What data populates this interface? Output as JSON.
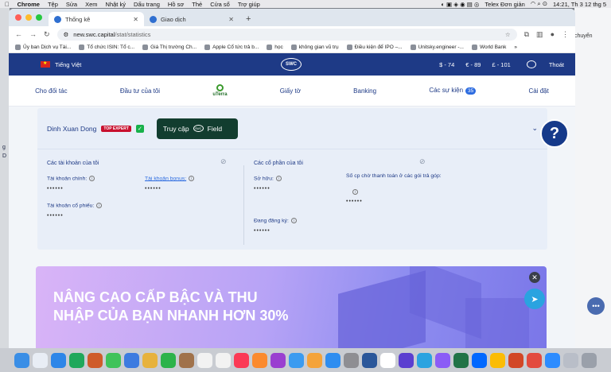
{
  "menubar": {
    "app": "Chrome",
    "items": [
      "Tệp",
      "Sửa",
      "Xem",
      "Nhật ký",
      "Dấu trang",
      "Hồ sơ",
      "Thẻ",
      "Cửa sổ",
      "Trợ giúp"
    ],
    "status_app": "Telex Đơn giản",
    "clock": "14:21, Th 3 12 thg 5"
  },
  "browser": {
    "tabs": [
      {
        "label": "Thống kê",
        "active": true
      },
      {
        "label": "Giao dịch",
        "active": false
      }
    ],
    "url_host": "new.swc.capital",
    "url_path": "/stat/statistics",
    "side_text": "chuyển"
  },
  "bookmarks": [
    "Ủy ban Dịch vụ Tài...",
    "Tổ chức ISIN: Tổ c...",
    "Giá Thị trường Ch...",
    "Apple Cổ tức trả b...",
    "học",
    "không gian vũ trụ",
    "Điều kiện để IPO –...",
    "Unitsky.engineer -...",
    "World Bank"
  ],
  "site": {
    "language": "Tiếng Việt",
    "logo": "SWC",
    "rates": [
      "$ - 74",
      "€ - 89",
      "£ - 101"
    ],
    "logout": "Thoát",
    "nav": {
      "partners": "Cho đối tác",
      "my_investment": "Đầu tư của tôi",
      "uterra": "uTerra",
      "documents": "Giấy tờ",
      "banking": "Banking",
      "events": "Các sự kiện",
      "events_count": "35",
      "settings": "Cài đặt"
    },
    "user": {
      "name": "Dinh Xuan Dong",
      "badge": "TOP EXPERT",
      "access_prefix": "Truy cập",
      "access_logo": "SWC",
      "access_suffix": "Field"
    },
    "accounts": {
      "title": "Các tài khoản của tôi",
      "main": "Tài khoản chính:",
      "main_value": "••••••",
      "bonus": "Tài khoản bonus:",
      "bonus_value": "••••••",
      "stock": "Tài khoản cổ phiếu:",
      "stock_value": "••••••"
    },
    "shares": {
      "title": "Các cổ phần của tôi",
      "owned": "Sở hữu:",
      "owned_value": "••••••",
      "pending": "Số cp chờ thanh toán ở các gói trả góp:",
      "pending_value": "••••••",
      "registering": "Đang đăng ký:",
      "registering_value": "••••••"
    },
    "help": "?",
    "promo": {
      "headline": "NÂNG CAO CẤP BẬC VÀ THU NHẬP CỦA BẠN NHANH HƠN 30%"
    },
    "close": "✕"
  },
  "left_edge": [
    "g",
    "D"
  ]
}
